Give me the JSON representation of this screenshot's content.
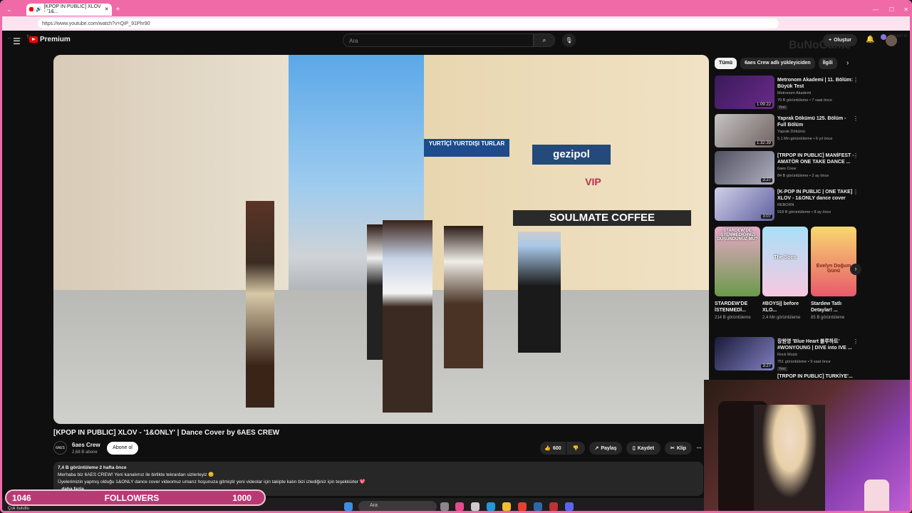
{
  "browser": {
    "tab_title": "[KPOP IN PUBLIC] XLOV - '1&...",
    "url": "https://www.youtube.com/watch?v=QiP_91Phr90",
    "chat_label": "Sohbet et"
  },
  "youtube": {
    "logo": "Premium",
    "search_placeholder": "Ara",
    "create_label": "Oluştur"
  },
  "video": {
    "title": "[KPOP IN PUBLIC] XLOV - '1&ONLY' | Dance Cover by 6AES CREW",
    "channel": "6aes Crew",
    "subscribers": "2,68 B abone",
    "subscribe_label": "Abone ol",
    "likes": "600",
    "share_label": "Paylaş",
    "save_label": "Kaydet",
    "clip_label": "Klip",
    "views_date": "7,4 B görüntüleme  2 hafta önce",
    "desc_line1": "Merhaba biz 6AES CREW! Yeni kanalımız ile birlikte tekrardan sizlerleyiz 😊",
    "desc_line2": "Üyelerimizin yapmış olduğu 1&ONLY dance cover videomuz umarız hoşunuza gitmiştir yeni videolar için takipte kalın bizi izlediğiniz için teşekkürler 💖",
    "more": "...daha fazla",
    "scene_sign1": "gezipol",
    "scene_sign2": "SOULMATE COFFEE",
    "scene_sign3": "YURTİÇİ YURTDIŞI TURLAR",
    "scene_sign4": "VIP"
  },
  "sidebar": {
    "chips": [
      "Tümü",
      "6aes Crew adlı yükleyiciden",
      "İlgili"
    ],
    "recs": [
      {
        "title": "Metronom Akademi | 11. Bölüm: Büyük Test",
        "channel": "Metronom Akademi",
        "meta": "79 B görüntüleme • 7 saat önce",
        "duration": "1:09:22",
        "badge": "Yeni"
      },
      {
        "title": "Yaprak Dökümü 125. Bölüm - Full Bölüm",
        "channel": "Yaprak Dökümü",
        "meta": "5,1 Mn görüntüleme • 6 yıl önce",
        "duration": "1:32:39",
        "badge": ""
      },
      {
        "title": "[TRPOP IN PUBLIC] MANİFEST - AMATÖR ONE TAKE DANCE ...",
        "channel": "6aes Crew",
        "meta": "84 B görüntüleme • 2 ay önce",
        "duration": "3:27",
        "badge": ""
      },
      {
        "title": "[K-POP IN PUBLIC | ONE TAKE] XLOV - 1&ONLY dance cover",
        "channel": "REBORN",
        "meta": "918 B görüntüleme • 8 ay önce",
        "duration": "3:07",
        "badge": ""
      },
      {
        "title": "장원영 'Blue Heart 블루하트' #WONYOUNG | DIVE into IVE ...",
        "channel": "Rock Music",
        "meta": "751 görüntüleme • 9 saat önce",
        "duration": "3:27",
        "badge": "Yeni"
      }
    ],
    "shorts": [
      {
        "title": "STARDEW'DE İSTENMEDİ...",
        "views": "214 B görüntüleme"
      },
      {
        "title": "#BOYS|| before XLO...",
        "views": "2,4 Mn görüntüleme"
      },
      {
        "title": "Stardew Tatlı Detaylar! ...",
        "views": "85 B görüntüleme"
      }
    ],
    "short_overlay": [
      "STARDEW'DE İSTENMEDİĞİNİZİ DÜŞÜNDÜNÜZ MÜ?",
      "The Sons",
      "Evelyn Doğum Günü"
    ],
    "partial_next": "[TRPOP IN PUBLIC] TURKİYE'..."
  },
  "overlay": {
    "watermark": "BuNoGame",
    "followers_left": "1046",
    "followers_label": "FOLLOWERS",
    "followers_right": "1000"
  },
  "taskbar": {
    "search": "Ara",
    "status": "Çok bulutlu"
  }
}
